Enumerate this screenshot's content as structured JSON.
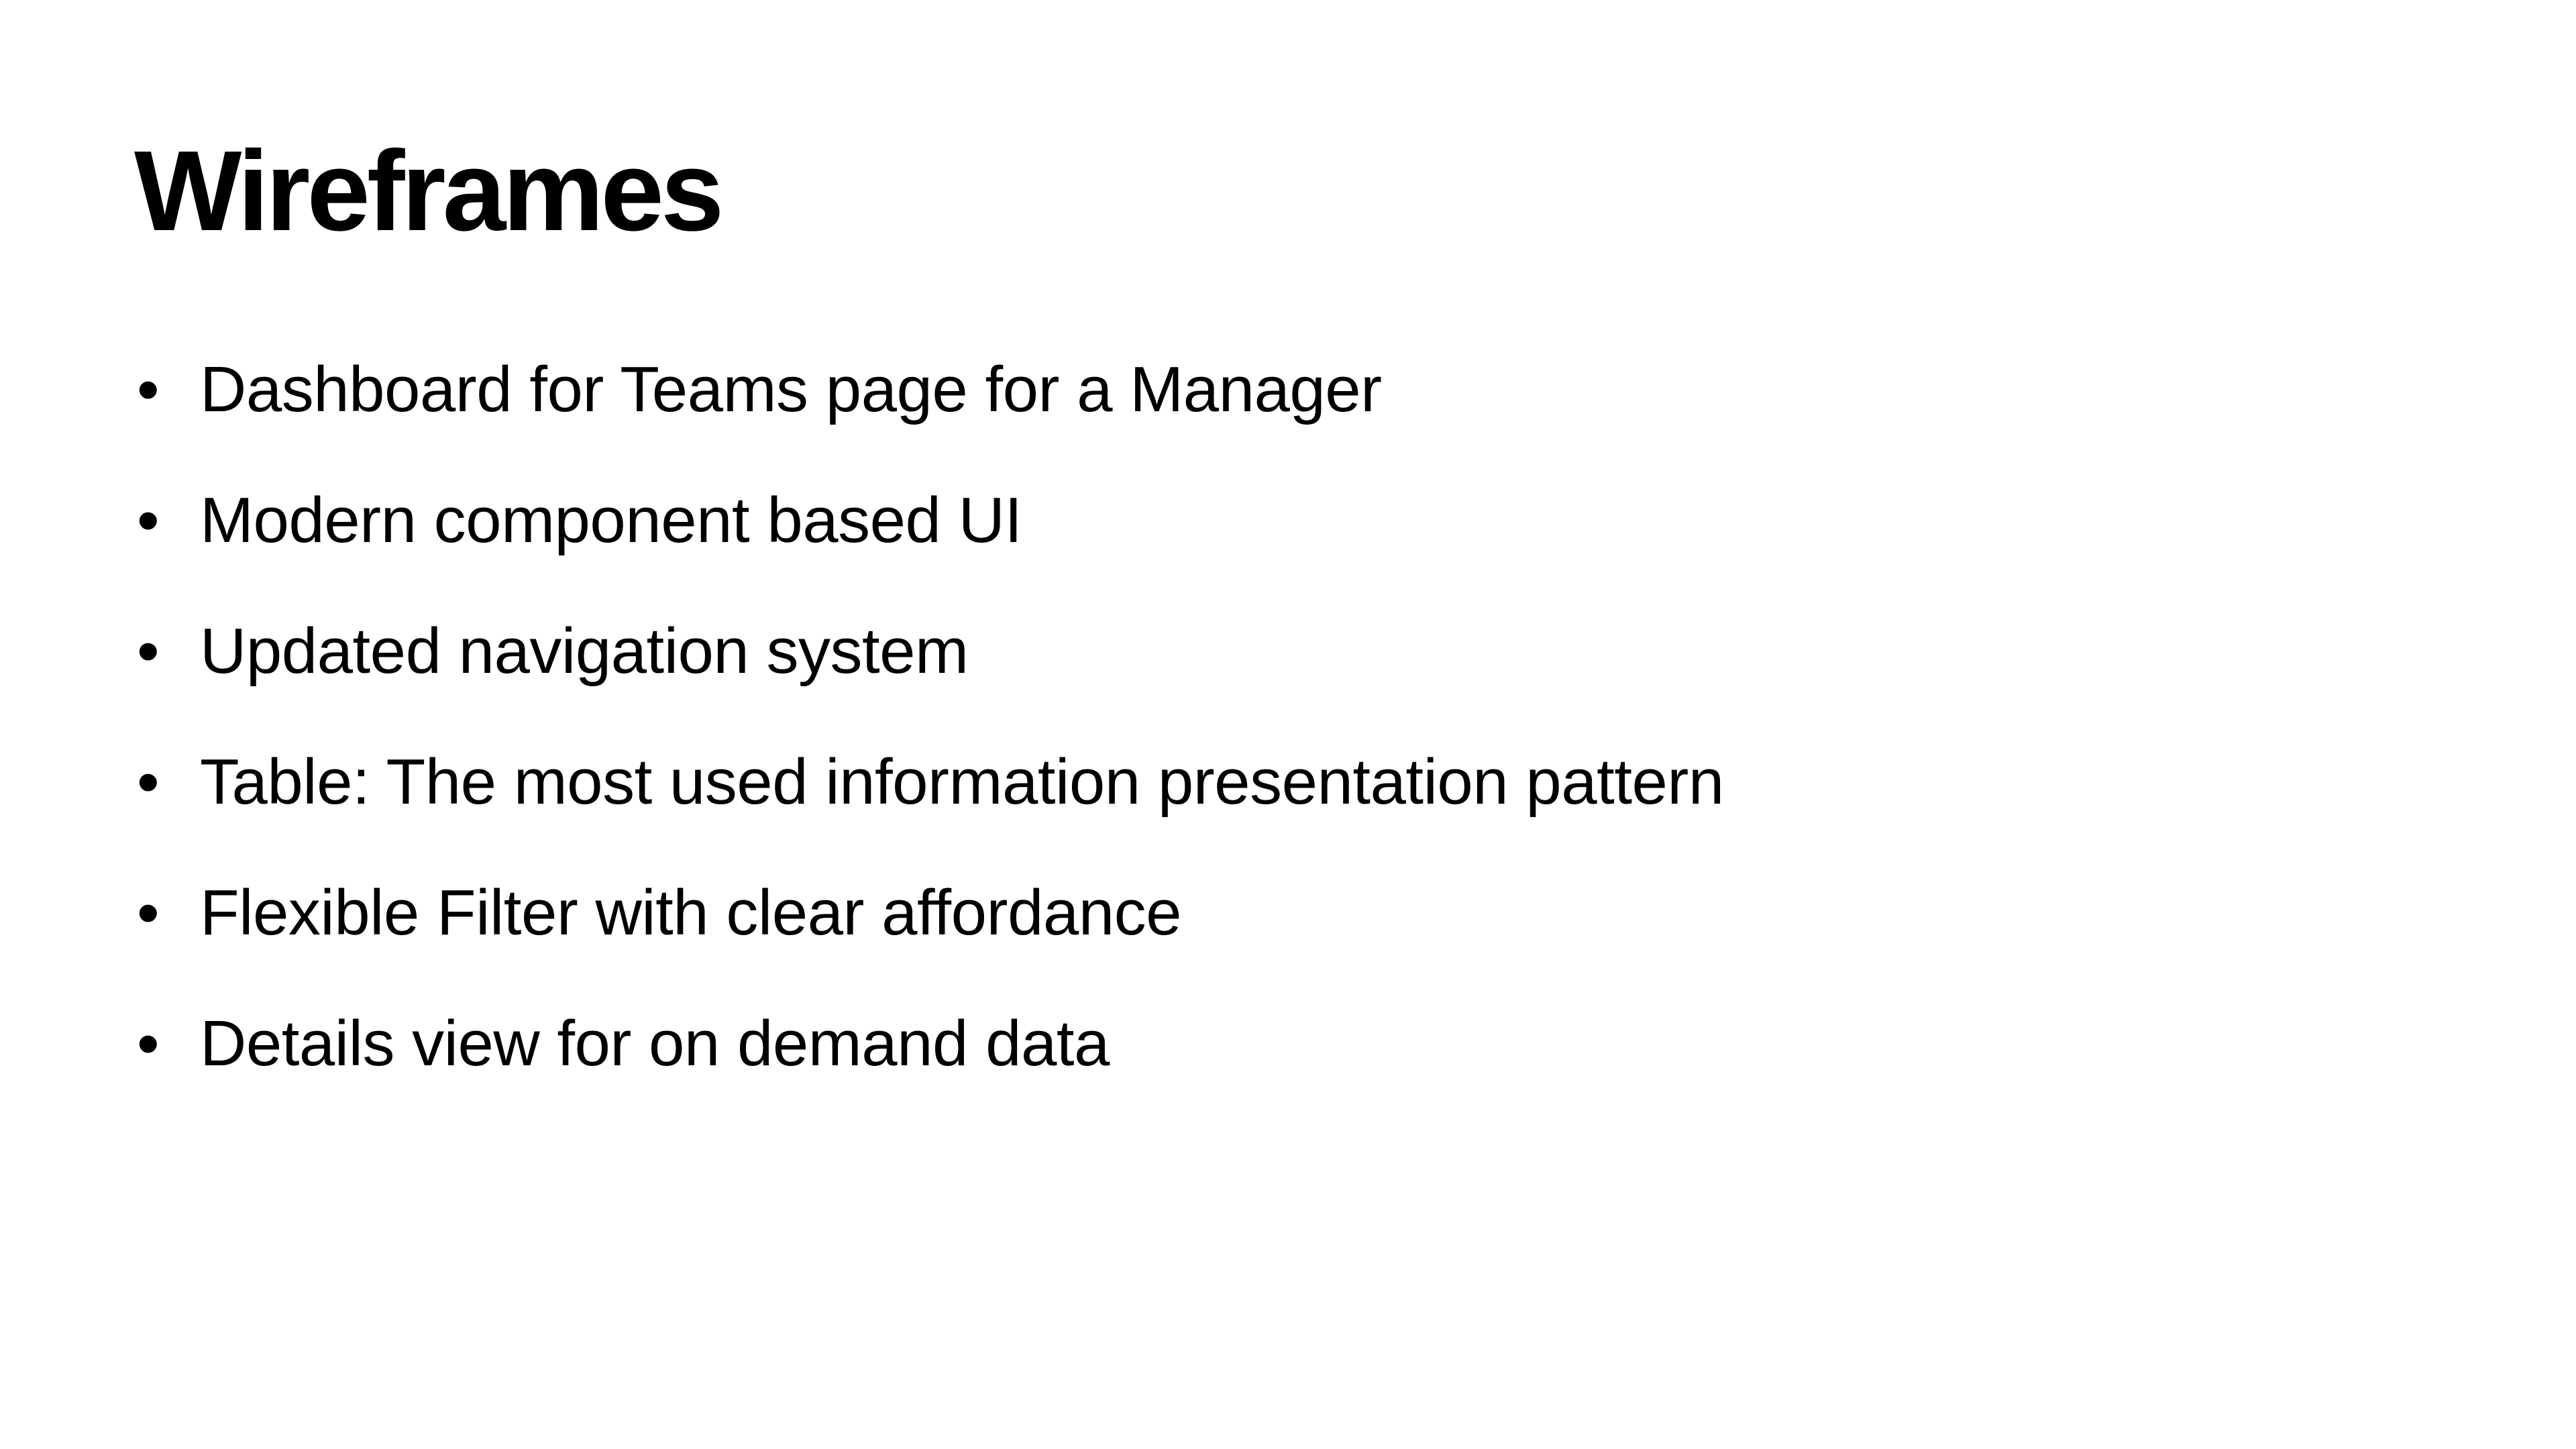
{
  "slide": {
    "title": "Wireframes",
    "bullet_glyph": "•",
    "bullets": [
      "Dashboard for Teams page for a Manager",
      "Modern component based UI",
      "Updated navigation system",
      "Table: The most used information presentation pattern",
      "Flexible Filter with clear affordance",
      "Details view for on demand data"
    ]
  }
}
